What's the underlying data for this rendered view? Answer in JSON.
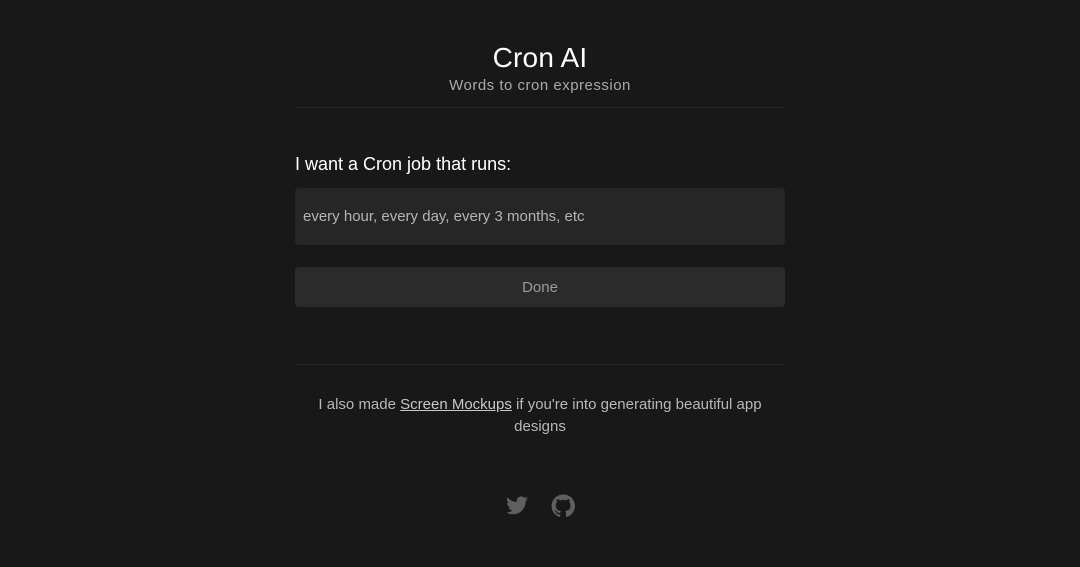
{
  "header": {
    "title": "Cron AI",
    "subtitle": "Words to cron expression"
  },
  "form": {
    "label": "I want a Cron job that runs:",
    "input_value": "",
    "input_placeholder": "every hour, every day, every 3 months, etc",
    "done_label": "Done"
  },
  "promo": {
    "prefix": "I also made ",
    "link_text": "Screen Mockups",
    "suffix": " if you're into generating beautiful app designs"
  },
  "social": {
    "icons": [
      "twitter-icon",
      "github-icon"
    ]
  },
  "colors": {
    "background": "#181818",
    "input_bg": "#262626",
    "button_bg": "#2b2b2b",
    "icon": "#5f5f5f"
  }
}
